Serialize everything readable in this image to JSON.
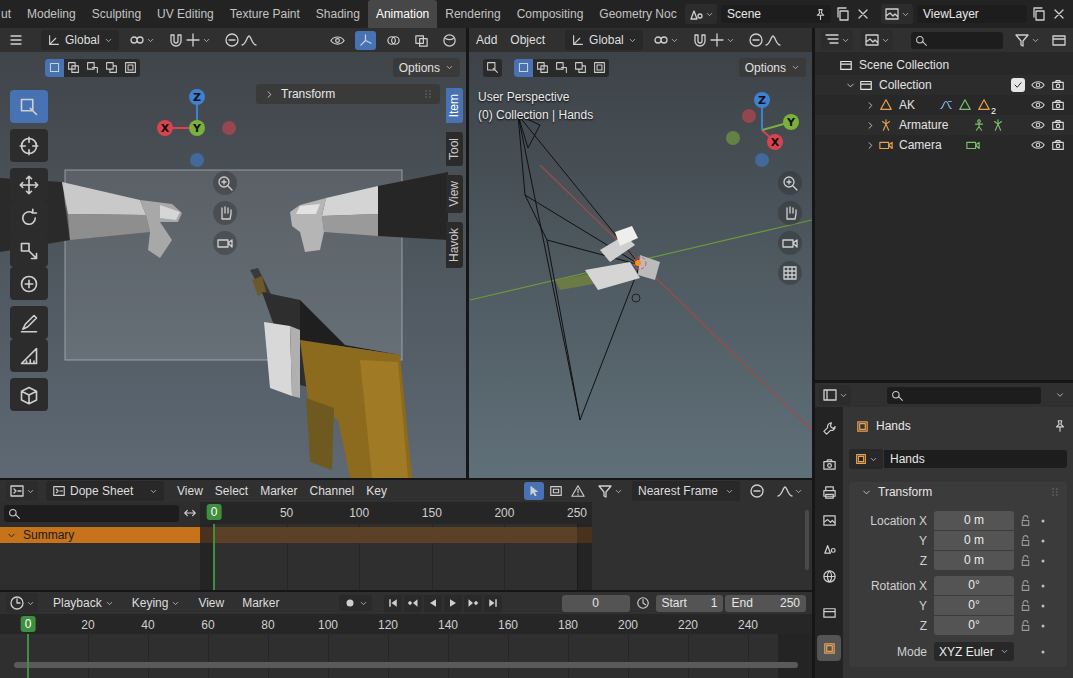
{
  "workspace_tabs": [
    {
      "label": "ut",
      "selected": false
    },
    {
      "label": "Modeling",
      "selected": false
    },
    {
      "label": "Sculpting",
      "selected": false
    },
    {
      "label": "UV Editing",
      "selected": false
    },
    {
      "label": "Texture Paint",
      "selected": false
    },
    {
      "label": "Shading",
      "selected": false
    },
    {
      "label": "Animation",
      "selected": true
    },
    {
      "label": "Rendering",
      "selected": false
    },
    {
      "label": "Compositing",
      "selected": false
    },
    {
      "label": "Geometry Noc",
      "selected": false
    }
  ],
  "scene": "Scene",
  "view_layer": "ViewLayer",
  "camera_view": {
    "orientation": "Global",
    "options": "Options",
    "header_toggles": [
      {
        "selected": false
      },
      {
        "selected": true
      },
      {
        "selected": false
      },
      {
        "selected": false
      },
      {
        "selected": false
      }
    ],
    "select_modes": [
      {
        "selected": true
      },
      {
        "selected": false
      },
      {
        "selected": false
      },
      {
        "selected": false
      },
      {
        "selected": false
      }
    ],
    "toolbar": [
      {
        "selected": true
      },
      {
        "selected": false
      },
      {
        "selected": false
      },
      {
        "selected": false
      },
      {
        "selected": false
      },
      {
        "selected": false
      },
      {
        "selected": false
      },
      {
        "selected": false
      },
      {
        "selected": false
      }
    ],
    "gizmo_axes": [
      {
        "label": "X",
        "color": "#d9434f"
      },
      {
        "label": "Y",
        "color": "#7bb03a"
      },
      {
        "label": "Z",
        "color": "#3f80d2"
      }
    ],
    "transform_panel": {
      "label": "Transform",
      "expanded": false
    },
    "sidebar_tabs": [
      {
        "label": "Item",
        "selected": true
      },
      {
        "label": "Tool",
        "selected": false
      },
      {
        "label": "View",
        "selected": false
      },
      {
        "label": "Havok",
        "selected": false
      }
    ]
  },
  "perspective_view": {
    "menus": [
      "Add",
      "Object"
    ],
    "orientation": "Global",
    "options": "Options",
    "select_modes": [
      {
        "selected": true
      },
      {
        "selected": false
      },
      {
        "selected": false
      },
      {
        "selected": false
      },
      {
        "selected": false
      }
    ],
    "view_name": "User Perspective",
    "context": "(0) Collection | Hands",
    "gizmo_axes": [
      {
        "label": "X",
        "color": "#d9434f"
      },
      {
        "label": "Y",
        "color": "#7bb03a"
      },
      {
        "label": "Z",
        "color": "#3f80d2"
      }
    ]
  },
  "outliner": {
    "root": "Scene Collection",
    "items": [
      {
        "name": "Collection",
        "kind": "collection",
        "depth": 1,
        "expanded": true,
        "checked": true,
        "visible": true,
        "renderable": true
      },
      {
        "name": "AK",
        "kind": "mesh",
        "depth": 2,
        "expanded": false,
        "badge": "2",
        "visible": true,
        "renderable": true
      },
      {
        "name": "Armature",
        "kind": "armature",
        "depth": 2,
        "expanded": false,
        "visible": true,
        "renderable": true
      },
      {
        "name": "Camera",
        "kind": "camera",
        "depth": 2,
        "expanded": false,
        "visible": true,
        "renderable": true
      }
    ]
  },
  "properties": {
    "tabs": [
      {
        "selected": false
      },
      {
        "selected": false
      },
      {
        "selected": false
      },
      {
        "selected": false
      },
      {
        "selected": false
      },
      {
        "selected": false
      },
      {
        "selected": false
      },
      {
        "selected": true
      }
    ],
    "object": "Hands",
    "datablock": "Hands",
    "panel": {
      "label": "Transform",
      "expanded": true
    },
    "fields": [
      {
        "label": "Location X",
        "value": "0 m"
      },
      {
        "label": "Y",
        "value": "0 m"
      },
      {
        "label": "Z",
        "value": "0 m"
      },
      {
        "label": "Rotation X",
        "value": "0°"
      },
      {
        "label": "Y",
        "value": "0°"
      },
      {
        "label": "Z",
        "value": "0°"
      }
    ],
    "mode_label": "Mode",
    "mode": "XYZ Euler"
  },
  "dope_sheet": {
    "mode": "Dope Sheet",
    "menus": [
      "View",
      "Select",
      "Marker",
      "Channel",
      "Key"
    ],
    "tools": [
      {
        "selected": true
      },
      {
        "selected": false
      },
      {
        "selected": false
      }
    ],
    "snap": "Nearest Frame",
    "current_frame": "0",
    "ticks": [
      "50",
      "100",
      "150",
      "200",
      "250"
    ],
    "channels": [
      {
        "name": "Summary",
        "expanded": true
      }
    ]
  },
  "timeline": {
    "menus": [
      {
        "label": "Playback",
        "dropdown": true
      },
      {
        "label": "Keying",
        "dropdown": true
      },
      {
        "label": "View",
        "dropdown": false
      },
      {
        "label": "Marker",
        "dropdown": false
      }
    ],
    "auto_key": false,
    "frame": "0",
    "start_label": "Start",
    "start": "1",
    "end_label": "End",
    "end": "250",
    "current_frame": "0",
    "ticks": [
      "20",
      "40",
      "60",
      "80",
      "100",
      "120",
      "140",
      "160",
      "180",
      "200",
      "220",
      "240"
    ]
  }
}
